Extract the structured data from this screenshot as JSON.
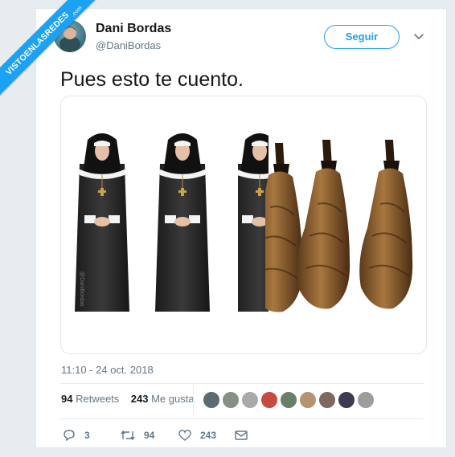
{
  "watermark": {
    "text": "VISTOENLASREDES",
    "tld": ".com"
  },
  "author": {
    "name": "Dani Bordas",
    "handle": "@DaniBordas"
  },
  "follow_button": {
    "label": "Seguir"
  },
  "tweet": {
    "text": "Pues esto te cuento."
  },
  "media": {
    "credit": "@DaniBordas"
  },
  "meta": {
    "timestamp": "11:10 - 24 oct. 2018"
  },
  "stats": {
    "retweets_count": "94",
    "retweets_label": "Retweets",
    "likes_count": "243",
    "likes_label": "Me gusta"
  },
  "actions": {
    "replies": "3",
    "retweets": "94",
    "likes": "243"
  },
  "colors": {
    "accent": "#1da1f2",
    "text": "#14171a",
    "muted": "#657786"
  }
}
